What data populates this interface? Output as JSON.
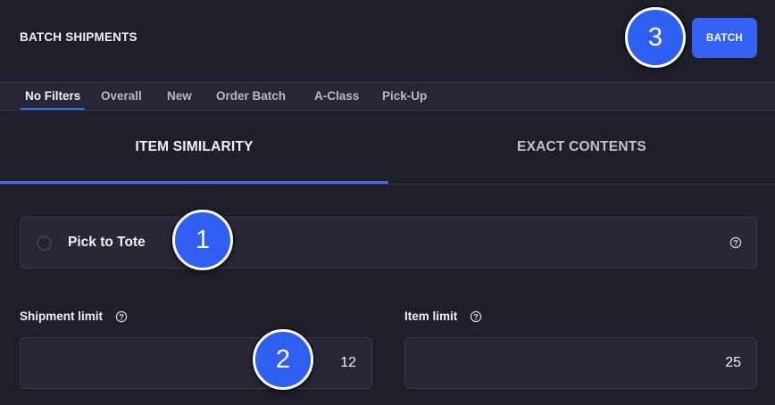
{
  "header": {
    "title": "BATCH SHIPMENTS",
    "batch_button_label": "BATCH"
  },
  "filters": [
    {
      "label": "No Filters",
      "active": true
    },
    {
      "label": "Overall",
      "active": false
    },
    {
      "label": "New",
      "active": false
    },
    {
      "label": "Order Batch",
      "active": false
    },
    {
      "label": "A-Class",
      "active": false
    },
    {
      "label": "Pick-Up",
      "active": false
    }
  ],
  "tabs": {
    "item_similarity": "ITEM SIMILARITY",
    "exact_contents": "EXACT CONTENTS",
    "selected": "ITEM SIMILARITY"
  },
  "pick_option": {
    "label": "Pick to Tote",
    "selected": false
  },
  "fields": {
    "shipment_limit": {
      "label": "Shipment limit",
      "value": "12"
    },
    "item_limit": {
      "label": "Item limit",
      "value": "25"
    }
  },
  "annotations": {
    "badge_1": "1",
    "badge_2": "2",
    "badge_3": "3"
  },
  "icons": {
    "help": "help-circle-icon",
    "radio": "radio-unchecked-icon"
  },
  "colors": {
    "background": "#1f1f2b",
    "accent": "#3f67f0",
    "button": "#3462f5",
    "card": "#272735"
  }
}
